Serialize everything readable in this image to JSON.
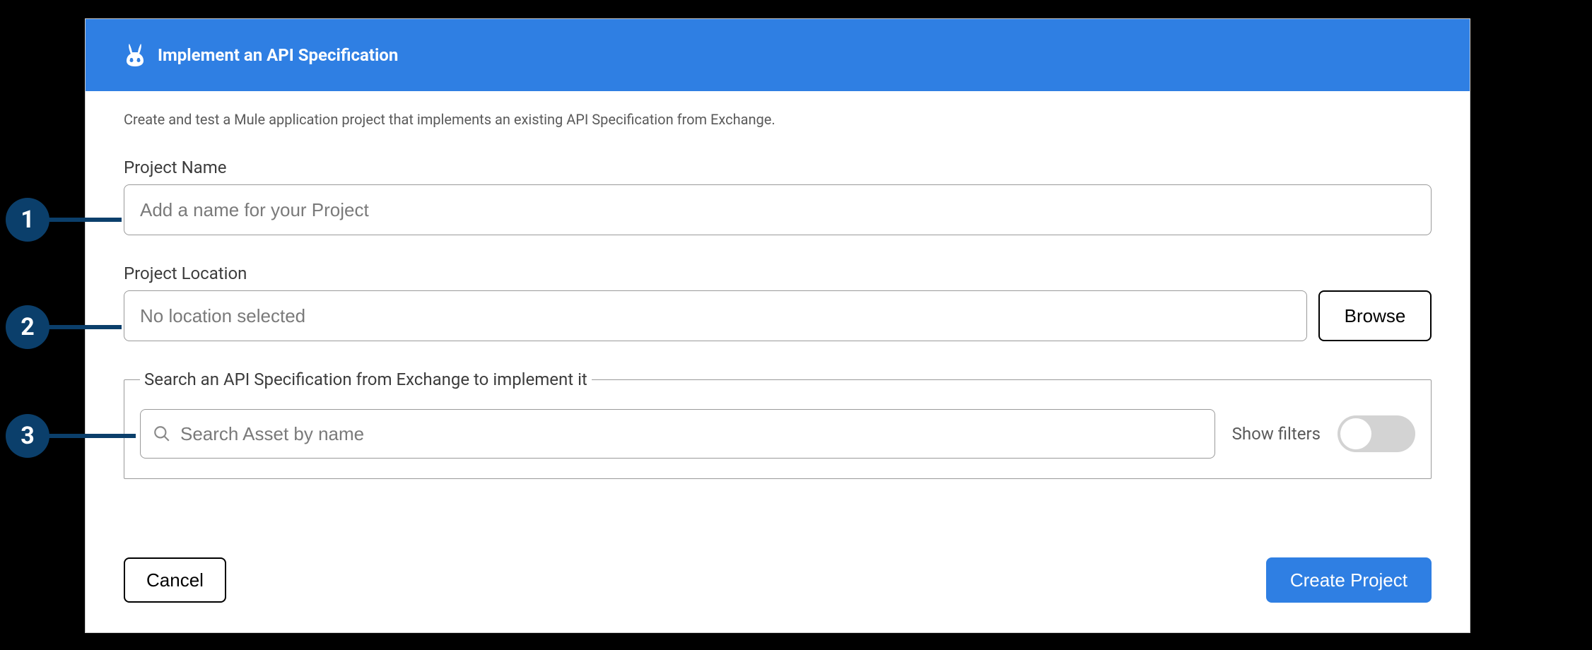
{
  "header": {
    "title": "Implement an API Specification"
  },
  "description": "Create and test a Mule application project that implements an existing API Specification from Exchange.",
  "projectName": {
    "label": "Project Name",
    "placeholder": "Add a name for your Project",
    "value": ""
  },
  "projectLocation": {
    "label": "Project Location",
    "placeholder": "No location selected",
    "value": "",
    "browse": "Browse"
  },
  "search": {
    "legend": "Search an API Specification from Exchange to implement it",
    "placeholder": "Search Asset by name",
    "value": "",
    "showFiltersLabel": "Show filters",
    "showFiltersOn": false
  },
  "footer": {
    "cancel": "Cancel",
    "create": "Create Project"
  },
  "callouts": {
    "one": "1",
    "two": "2",
    "three": "3"
  },
  "colors": {
    "primary": "#2f7fe3",
    "calloutBg": "#0b3f6b"
  }
}
